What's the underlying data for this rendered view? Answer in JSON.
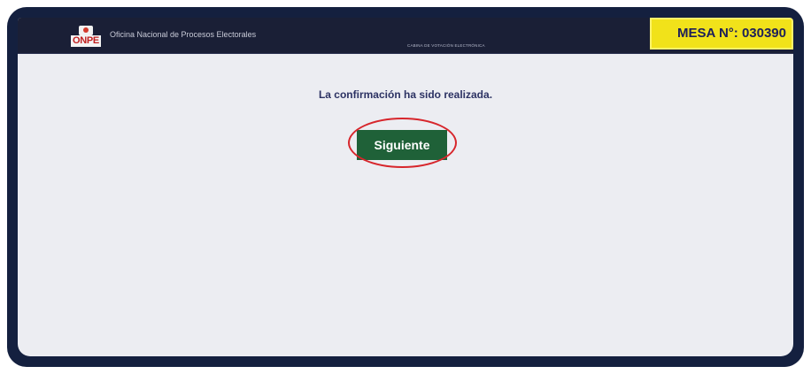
{
  "header": {
    "logo_text": "ONPE",
    "org_name": "Oficina Nacional de Procesos Electorales",
    "subtitle": "CABINA DE VOTACIÓN ELECTRÓNICA",
    "mesa_label": "MESA N°: 030390"
  },
  "main": {
    "message": "La confirmación ha sido realizada.",
    "next_button_label": "Siguiente"
  },
  "colors": {
    "frame": "#14203f",
    "header_bg": "#1a1f36",
    "mesa_bg": "#f1e21a",
    "button_bg": "#1f6138",
    "highlight": "#d7262c",
    "screen_bg": "#ecedf2"
  }
}
